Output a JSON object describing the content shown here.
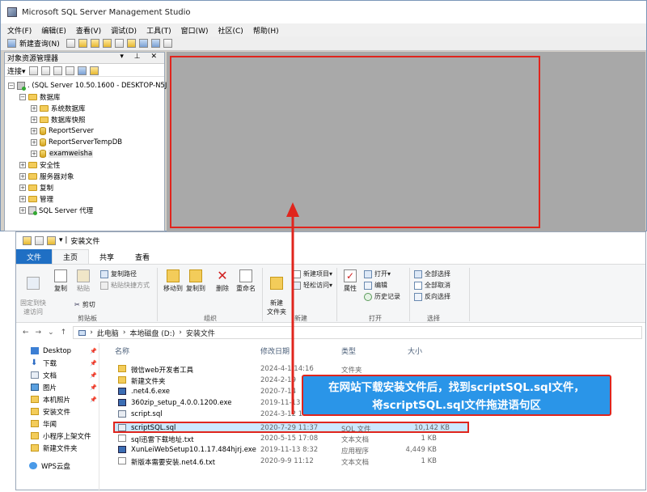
{
  "ssms": {
    "title": "Microsoft SQL Server Management Studio",
    "menu": [
      "文件(F)",
      "编辑(E)",
      "查看(V)",
      "调试(D)",
      "工具(T)",
      "窗口(W)",
      "社区(C)",
      "帮助(H)"
    ],
    "new_query": "新建查询(N)",
    "object_explorer": {
      "title": "对象资源管理器",
      "connect": "连接▾",
      "server": ". (SQL Server 10.50.1600 - DESKTOP-N5J",
      "databases": "数据库",
      "db_items": [
        "系统数据库",
        "数据库快照",
        "ReportServer",
        "ReportServerTempDB",
        "examweisha"
      ],
      "nodes": [
        "安全性",
        "服务器对象",
        "复制",
        "管理",
        "SQL Server 代理"
      ]
    }
  },
  "explorer": {
    "title": "安装文件",
    "tabs": [
      "文件",
      "主页",
      "共享",
      "查看"
    ],
    "ribbon": {
      "pin_quick": "固定到快\n速访问",
      "copy": "复制",
      "paste": "粘贴",
      "copy_path": "复制路径",
      "paste_shortcut": "粘贴快捷方式",
      "cut": "剪切",
      "clipboard": "剪贴板",
      "move_to": "移动到",
      "copy_to": "复制到",
      "delete": "删除",
      "rename": "重命名",
      "organize": "组织",
      "new_folder": "新建\n文件夹",
      "new_item": "新建项目▾",
      "easy_access": "轻松访问▾",
      "new": "新建",
      "properties": "属性",
      "open": "打开▾",
      "edit": "编辑",
      "history": "历史记录",
      "open_group": "打开",
      "select_all": "全部选择",
      "select_none": "全部取消",
      "invert": "反向选择",
      "select": "选择"
    },
    "address": [
      "此电脑",
      "本地磁盘 (D:)",
      "安装文件"
    ],
    "nav": [
      {
        "label": "Desktop",
        "pinned": true
      },
      {
        "label": "下载",
        "pinned": true
      },
      {
        "label": "文档",
        "pinned": true
      },
      {
        "label": "图片",
        "pinned": true
      },
      {
        "label": "本机照片",
        "pinned": true
      },
      {
        "label": "安装文件",
        "pinned": false
      },
      {
        "label": "华闻",
        "pinned": false
      },
      {
        "label": "小程序上架文件",
        "pinned": false
      },
      {
        "label": "新建文件夹",
        "pinned": false
      },
      {
        "label": "WPS云盘",
        "pinned": false
      }
    ],
    "columns": [
      "名称",
      "修改日期",
      "类型",
      "大小"
    ],
    "files": [
      {
        "name": "微信web开发者工具",
        "date": "2024-4-1 14:16",
        "type": "文件夹",
        "size": "",
        "icon": "folder"
      },
      {
        "name": "新建文件夹",
        "date": "2024-2-19",
        "type": "文件夹",
        "size": "",
        "icon": "folder"
      },
      {
        "name": ".net4.6.exe",
        "date": "2020-7-14",
        "type": "",
        "size": "",
        "icon": "exe"
      },
      {
        "name": "360zip_setup_4.0.0.1200.exe",
        "date": "2019-11-13",
        "type": "",
        "size": "",
        "icon": "exe"
      },
      {
        "name": "script.sql",
        "date": "2024-3-12 16:38",
        "type": "",
        "size": "",
        "icon": "sql"
      },
      {
        "name": "scriptSQL.sql",
        "date": "2020-7-29 11:37",
        "type": "SQL 文件",
        "size": "10,142 KB",
        "icon": "sql"
      },
      {
        "name": "sql迅雷下载地址.txt",
        "date": "2020-5-15 17:08",
        "type": "文本文档",
        "size": "1 KB",
        "icon": "doc"
      },
      {
        "name": "XunLeiWebSetup10.1.17.484hjrj.exe",
        "date": "2019-11-13 8:32",
        "type": "应用程序",
        "size": "4,449 KB",
        "icon": "exe"
      },
      {
        "name": "新版本需要安装.net4.6.txt",
        "date": "2020-9-9 11:12",
        "type": "文本文档",
        "size": "1 KB",
        "icon": "doc"
      }
    ]
  },
  "callout": {
    "line1": "在网站下载安装文件后，找到scriptSQL.sql文件，",
    "line2": "将scriptSQL.sql文件拖进语句区"
  },
  "colors": {
    "highlight": "#e0251d",
    "callout": "#2a95e8",
    "selection": "#cce8ff"
  }
}
